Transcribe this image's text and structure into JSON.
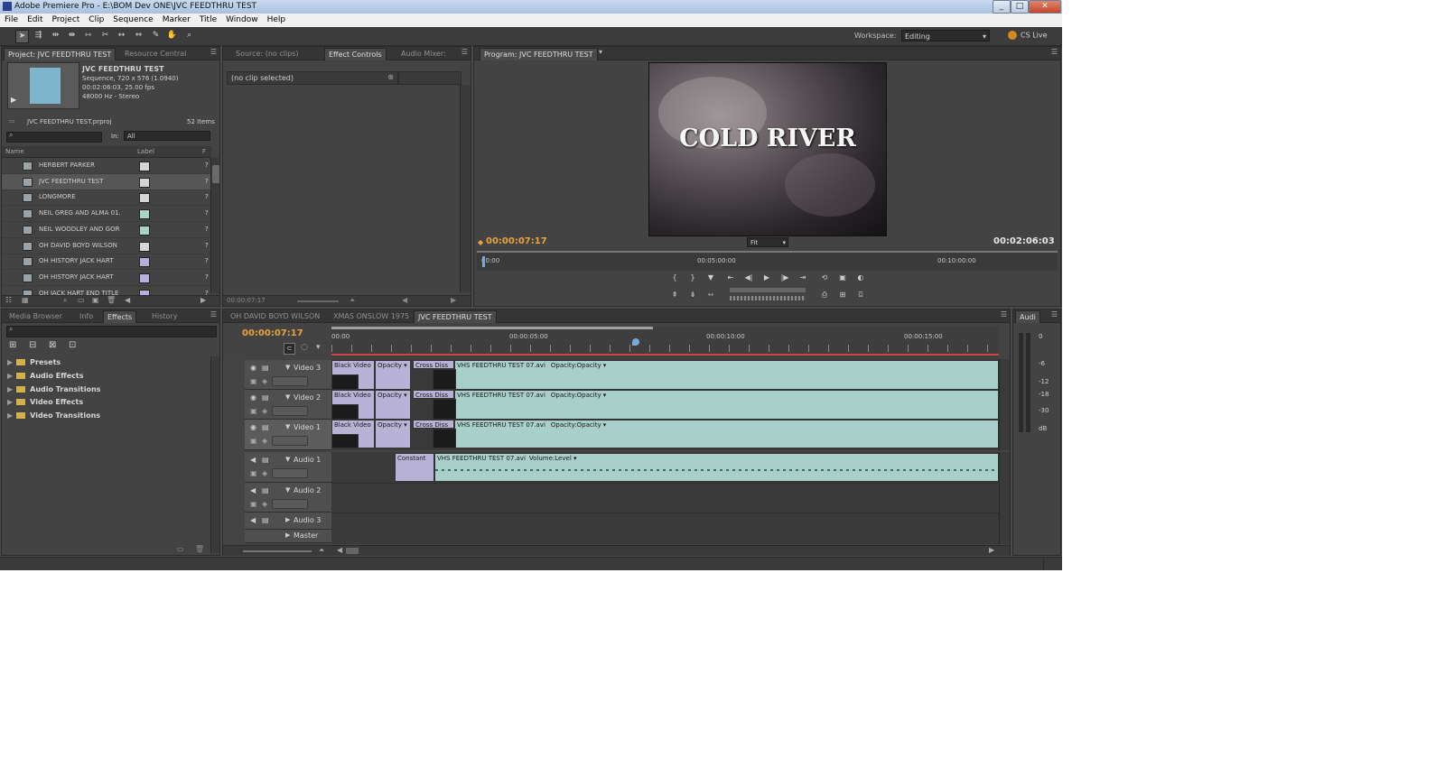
{
  "window": {
    "title": "Adobe Premiere Pro - E:\\BOM Dev ONE\\JVC FEEDTHRU TEST",
    "controls": [
      "_",
      "□",
      "✕"
    ]
  },
  "menu": [
    "File",
    "Edit",
    "Project",
    "Clip",
    "Sequence",
    "Marker",
    "Title",
    "Window",
    "Help"
  ],
  "toolbar": {
    "workspace_label": "Workspace:",
    "workspace_value": "Editing",
    "cs_live": "CS Live"
  },
  "project_panel": {
    "tabs": [
      "Project: JVC FEEDTHRU TEST",
      "Resource Central"
    ],
    "sequence_name": "JVC FEEDTHRU TEST",
    "sequence_info": [
      "Sequence, 720 x 576 (1.0940)",
      "00:02:06:03, 25.00 fps",
      "48000 Hz - Stereo"
    ],
    "file_name": "JVC FEEDTHRU TEST.prproj",
    "item_count": "52 Items",
    "in_label": "In:",
    "in_value": "All",
    "col_name": "Name",
    "col_label": "Label",
    "col_extra": "F",
    "items": [
      {
        "name": "HERBERT PARKER",
        "color": "#d2d6d4"
      },
      {
        "name": "JVC FEEDTHRU TEST",
        "color": "#d2d6d4"
      },
      {
        "name": "LONGMORE",
        "color": "#d2d6d4"
      },
      {
        "name": "NEIL GREG AND ALMA 01.",
        "color": "#a9d3c3"
      },
      {
        "name": "NEIL WOODLEY AND GOR",
        "color": "#a9d3c3"
      },
      {
        "name": "OH DAVID BOYD WILSON",
        "color": "#d2d6d4"
      },
      {
        "name": "OH HISTORY JACK HART",
        "color": "#b7b0dd"
      },
      {
        "name": "OH HISTORY JACK HART",
        "color": "#b7b0dd"
      },
      {
        "name": "OH JACK HART END TITLE",
        "color": "#b7b0dd"
      }
    ]
  },
  "source_panel": {
    "tabs": [
      "Source: (no clips)",
      "Effect Controls",
      "Audio Mixer:"
    ],
    "no_clip": "(no clip selected)",
    "timecode": "00:00:07:17"
  },
  "program_panel": {
    "tab": "Program: JVC FEEDTHRU TEST",
    "video_title": "COLD RIVER",
    "current_time": "00:00:07:17",
    "duration": "00:02:06:03",
    "zoom": "Fit",
    "ruler_ticks": [
      "00:00",
      "00:05:00:00",
      "00:10:00:00"
    ]
  },
  "effects_panel": {
    "tabs": [
      "Media Browser",
      "Info",
      "Effects",
      "History"
    ],
    "folders": [
      "Presets",
      "Audio Effects",
      "Audio Transitions",
      "Video Effects",
      "Video Transitions"
    ]
  },
  "timeline": {
    "tabs": [
      "OH DAVID BOYD WILSON",
      "XMAS ONSLOW 1975",
      "JVC FEEDTHRU TEST"
    ],
    "current_time": "00:00:07:17",
    "ruler_ticks": [
      "00:00",
      "00:00:05:00",
      "00:00:10:00",
      "00:00:15:00"
    ],
    "tracks": [
      "Video 3",
      "Video 2",
      "Video 1",
      "Audio 1",
      "Audio 2",
      "Audio 3",
      "Master"
    ],
    "clips": {
      "black_video": "Black Video",
      "opacity": "Opacity ▾",
      "cross_dissolve": "Cross Diss",
      "vhs": "VHS FEEDTHRU TEST 07.avi",
      "vhs_opacity": "Opacity:Opacity ▾",
      "constant": "Constant",
      "vhs_audio": "VHS FEEDTHRU TEST 07.avi",
      "volume": "Volume:Level ▾"
    }
  },
  "audio_meter": {
    "tab": "Audi",
    "labels": [
      "0",
      "-6",
      "-12",
      "-18",
      "-30",
      "dB"
    ]
  }
}
